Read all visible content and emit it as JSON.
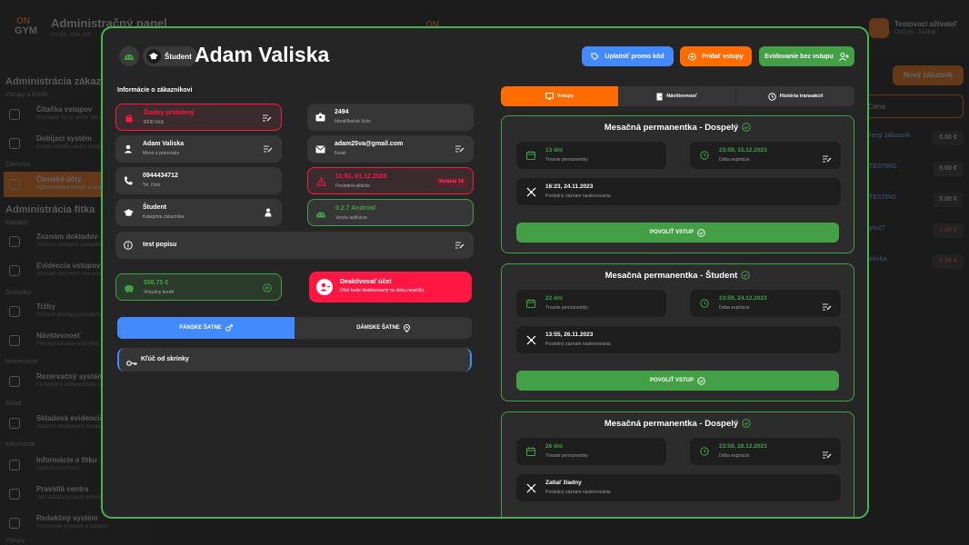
{
  "background": {
    "app_title": "Administračný panel",
    "app_version": "0.0.83 - ONLINE",
    "logo_on": "ON",
    "logo_gym": "GYM",
    "center_mark": "ON",
    "user": {
      "name": "Testovací užívateľ",
      "sub": "OnGym - Testing"
    },
    "sidebar": {
      "h1": "Administrácia zákazníkov",
      "sec1": "Vstupy a kredit",
      "items1": [
        {
          "title": "Čítačka vstupov",
          "sub": "Načítanie RFID alebo QR vstupu"
        },
        {
          "title": "Dobíjací systém",
          "sub": "Dobitie kreditu alebo vstupov"
        }
      ],
      "sec2": "Členstvo",
      "active": {
        "title": "Členské účty",
        "sub": "Administrácia členov a účtov"
      },
      "h2": "Administrácia fitka",
      "sec3": "Doklady",
      "items3": [
        {
          "title": "Zoznam dokladov",
          "sub": "Zoznam všetkých dokladov"
        },
        {
          "title": "Evidencia vstupov",
          "sub": "Zoznam použitých vstupov"
        }
      ],
      "sec4": "Štatistiky",
      "items4": [
        {
          "title": "Tržby",
          "sub": "Prehľad predaja produktov"
        },
        {
          "title": "Návštevnosť",
          "sub": "Prehľad návštevnosti fitka"
        }
      ],
      "sec5": "Rezervácie",
      "items5": [
        {
          "title": "Rezervačný systém",
          "sub": "Kompletná administrácia rezervácií"
        }
      ],
      "sec6": "Sklad",
      "items6": [
        {
          "title": "Skladová evidencia",
          "sub": "Zoznam skladových evidencií"
        }
      ],
      "sec7": "Informácie",
      "items7": [
        {
          "title": "Informácie o fitku",
          "sub": "Úprava informácií"
        },
        {
          "title": "Pravidlá centra",
          "sub": "Vaši zákazníci budú informovaní"
        },
        {
          "title": "Redakčný systém",
          "sub": "Vytvorenie noviniek a článkov"
        }
      ],
      "sec8": "Vstupy"
    },
    "right": {
      "new_customer": "Nový zákazník",
      "col_header": "Cena",
      "rows": [
        {
          "name": "rený zákazník",
          "value": "0.00 €",
          "neg": false
        },
        {
          "name": "TESTING",
          "value": "0.00 €",
          "neg": false
        },
        {
          "name": "TESTING",
          "value": "0.00 €",
          "neg": false
        },
        {
          "name": "ym27",
          "value": "1.33 €",
          "neg": true
        },
        {
          "name": "aliska",
          "value": "0.35 €",
          "neg": true
        }
      ]
    }
  },
  "modal": {
    "role": "Študent",
    "name": "Adam Valiska",
    "buttons": {
      "promo": "Uplatniť promo kód",
      "add_entries": "Pridať vstupy",
      "no_entry_record": "Evidovanie bez vstupu"
    },
    "section_title": "Informácie o zákazníkovi",
    "info": {
      "rfid": {
        "value": "Žiadny pridelený",
        "label": "RFID kľúč"
      },
      "id": {
        "value": "2494",
        "label": "Identifikačné číslo"
      },
      "name": {
        "value": "Adam Valiska",
        "label": "Meno a priezvisko"
      },
      "email": {
        "value": "adam25va@gmail.com",
        "label": "Email"
      },
      "phone": {
        "value": "0944434712",
        "label": "Tel. číslo"
      },
      "last_activity": {
        "value": "11:51, 01.12.2023",
        "label": "Posledná aktivita",
        "badge": "Relácia 18"
      },
      "category": {
        "value": "Študent",
        "label": "Kategória zákazníka"
      },
      "app_version": {
        "value": "0.2.7 Android",
        "label": "Verzia aplikácie"
      },
      "note": {
        "value": "test popisu"
      }
    },
    "credit": {
      "value": "558.75 €",
      "label": "Virtuálny kredit"
    },
    "deactivate": {
      "value": "Deaktivovať účet",
      "label": "Účet bude deaktivovaný na dobu neurčitú."
    },
    "lockers": {
      "men": "PÁNSKE ŠATNE",
      "women": "DÁMSKE ŠATNE",
      "key": "Kľúč od skrinky"
    },
    "tabs": {
      "entries": "Vstupy",
      "attendance": "Návštevnosť",
      "history": "História transakcií"
    },
    "passes": [
      {
        "title": "Mesačná permanentka - Dospelý",
        "duration": "13 dní",
        "duration_label": "Trvanie permanentky",
        "expiry": "23:59, 15.12.2023",
        "expiry_label": "Doba expirácie",
        "last": "16:23, 24.11.2023",
        "last_label": "Posledný záznam naskenovania",
        "allow": "POVOLIŤ VSTUP"
      },
      {
        "title": "Mesačná permanentka - Študent",
        "duration": "22 dní",
        "duration_label": "Trvanie permanentky",
        "expiry": "23:59, 24.12.2023",
        "expiry_label": "Doba expirácie",
        "last": "13:55, 26.11.2023",
        "last_label": "Posledný záznam naskenovania",
        "allow": "POVOLIŤ VSTUP"
      },
      {
        "title": "Mesačná permanentka - Dospelý",
        "duration": "26 dní",
        "duration_label": "Trvanie permanentky",
        "expiry": "23:59, 28.12.2023",
        "expiry_label": "Doba expirácie",
        "last": "Zatiaľ žiadny",
        "last_label": "Posledný záznam naskenovania",
        "allow": "POVOLIŤ VSTUP"
      }
    ]
  },
  "colors": {
    "accent": "#ff6d00",
    "success": "#43a047",
    "danger": "#ff1744",
    "info": "#448aff"
  }
}
